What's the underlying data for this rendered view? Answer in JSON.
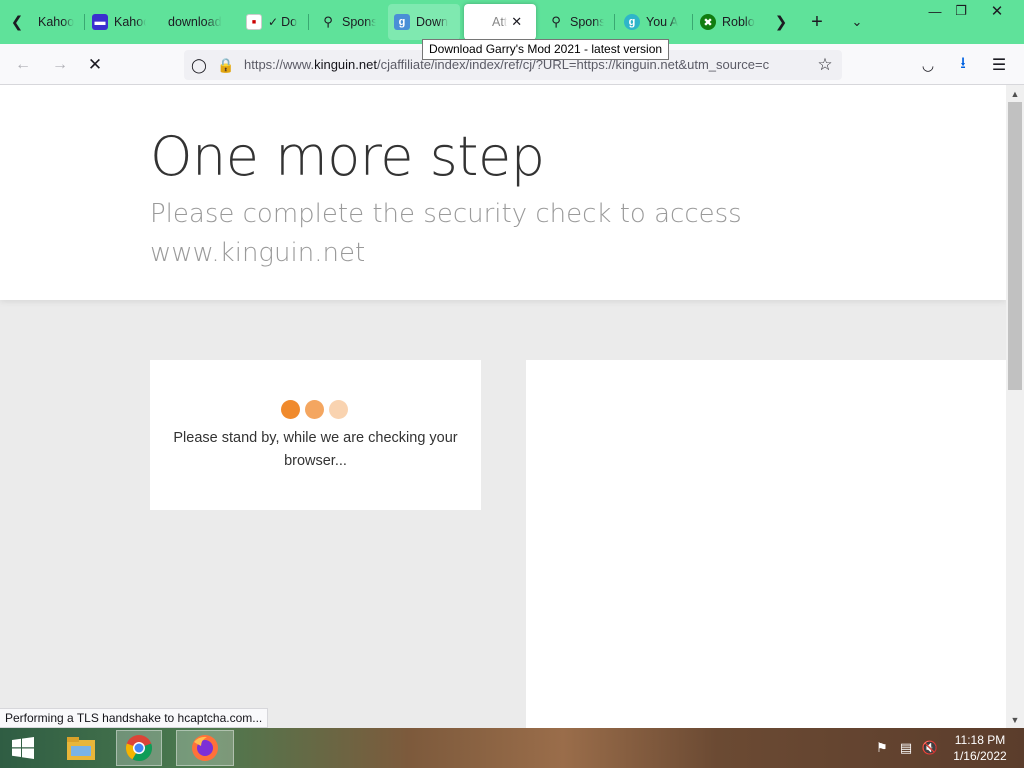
{
  "tabs": [
    {
      "label": "Kahoo",
      "favicon": "kahoot-favicon",
      "x": 0
    },
    {
      "label": "Kahoo",
      "favicon": "kahoot-favicon"
    },
    {
      "label": "download",
      "favicon": "none"
    },
    {
      "label": "Do",
      "favicon": "checkmark-favicon"
    },
    {
      "label": "Spons",
      "favicon": "search-favicon"
    },
    {
      "label": "Down",
      "favicon": "gametop-favicon"
    },
    {
      "label": "Att",
      "favicon": "none"
    },
    {
      "label": "Spons",
      "favicon": "search-favicon"
    },
    {
      "label": "You A",
      "favicon": "g-favicon"
    },
    {
      "label": "Roblo",
      "favicon": "xbox-favicon"
    }
  ],
  "tooltip": "Download Garry's Mod 2021 - latest version",
  "url": {
    "prefix": "https://www.",
    "domain": "kinguin.net",
    "rest": "/cjaffiliate/index/index/ref/cj/?URL=https://kinguin.net&utm_source=c"
  },
  "page": {
    "title": "One more step",
    "subtitle": "Please complete the security check to access www.kinguin.net",
    "standby": "Please stand by, while we are checking your browser...",
    "dot_colors": [
      "#f08a2c",
      "#f4a660",
      "#f9d3b0"
    ]
  },
  "status": "Performing a TLS handshake to hcaptcha.com...",
  "taskbar": {
    "time": "11:18 PM",
    "date": "1/16/2022"
  },
  "colors": {
    "tabbar": "#5fe29a",
    "accent": "#f08a2c"
  }
}
